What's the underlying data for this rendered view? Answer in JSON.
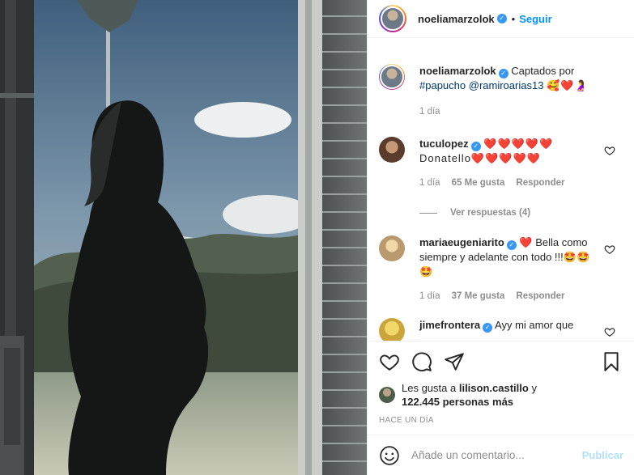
{
  "post": {
    "image_alt": "Silhouette of a pregnant woman at a window overlooking trees and sky",
    "author": {
      "username": "noeliamarzolok",
      "verified_icon": "verified-badge-icon"
    },
    "follow_label": "Seguir",
    "dot": "•"
  },
  "caption": {
    "username": "noeliamarzolok",
    "text_before": "Captados por",
    "hashtag": "#papucho",
    "mention": "@ramiroarias13",
    "emojis": "🥰❤️🤰",
    "time": "1 día"
  },
  "comments": [
    {
      "username": "tuculopez",
      "text": "❤️❤️❤️❤️❤️",
      "text2": "Donatello❤️❤️❤️❤️❤️",
      "time": "1 día",
      "likes": "65 Me gusta",
      "reply": "Responder",
      "view_replies": "Ver respuestas (4)"
    },
    {
      "username": "mariaeugeniarito",
      "text": "❤️ Bella como siempre y adelante con todo !!!🤩🤩🤩",
      "time": "1 día",
      "likes": "37 Me gusta",
      "reply": "Responder"
    },
    {
      "username": "jimefrontera",
      "text": "Ayy mi amor que"
    }
  ],
  "likes_summary": {
    "prefix": "Les gusta a",
    "user": "lilison.castillo",
    "conj": "y",
    "count": "122.445 personas más"
  },
  "time_ago": "HACE UN DÍA",
  "composer": {
    "placeholder": "Añade un comentario...",
    "publish_label": "Publicar"
  },
  "colors": {
    "accent": "#0095f6",
    "verified": "#3897f0",
    "publish_disabled": "#b2dffc",
    "muted": "#8e8e8e"
  }
}
